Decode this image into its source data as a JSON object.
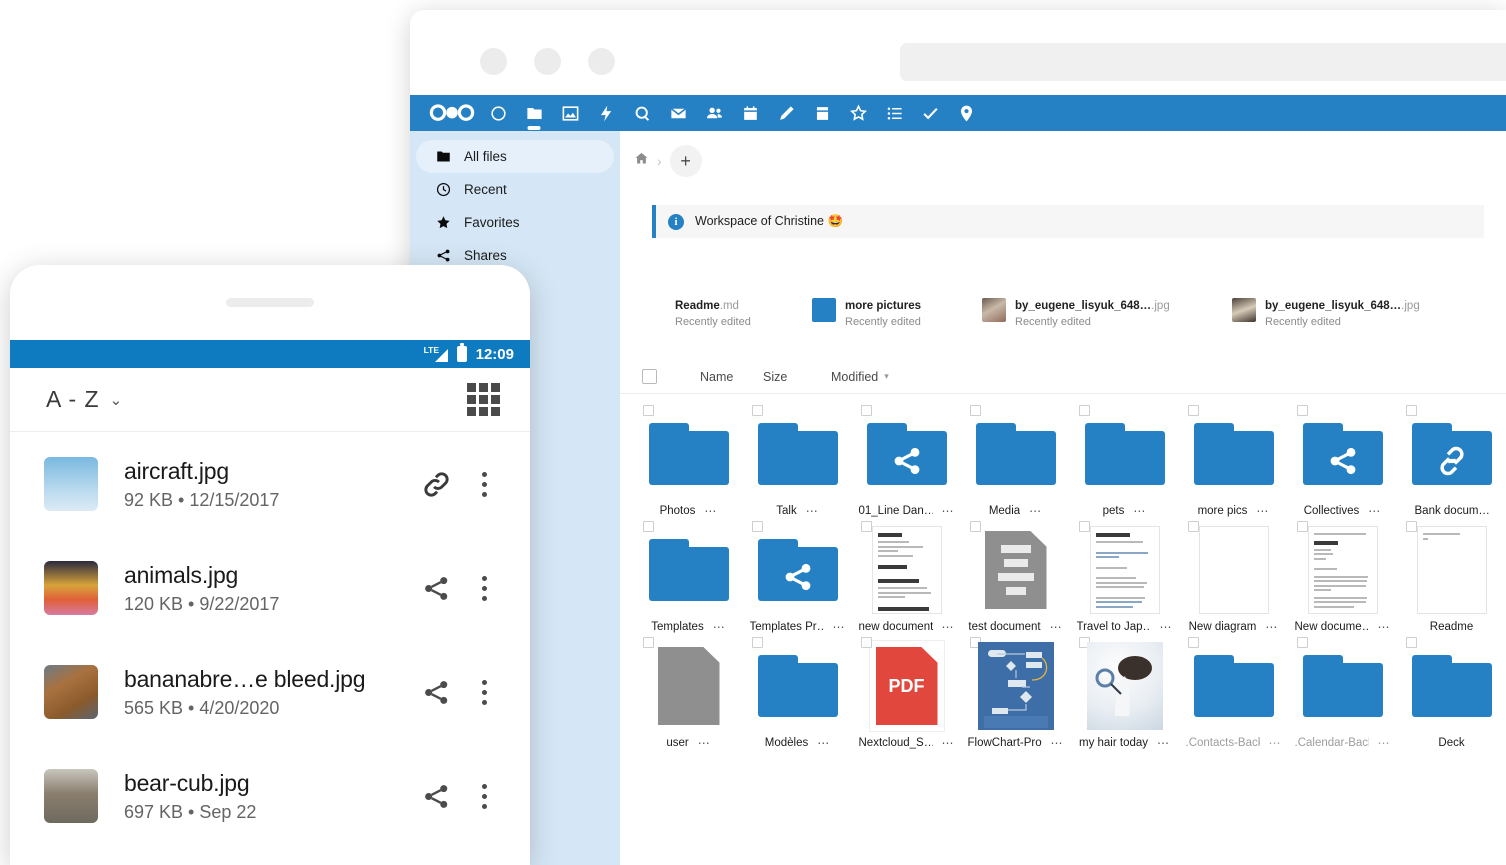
{
  "browser": {
    "traffic_lights": [
      "close",
      "minimize",
      "maximize"
    ],
    "address_value": "",
    "address_placeholder": ""
  },
  "nextcloud": {
    "brand_color": "#2581c4",
    "nav": [
      {
        "name": "logo",
        "icon": "nextcloud-logo"
      },
      {
        "name": "dashboard",
        "icon": "circle-icon",
        "active": false
      },
      {
        "name": "files",
        "icon": "folder-icon",
        "active": true
      },
      {
        "name": "photos",
        "icon": "image-icon",
        "active": false
      },
      {
        "name": "activity",
        "icon": "bolt-icon",
        "active": false
      },
      {
        "name": "search",
        "icon": "search-icon",
        "active": false
      },
      {
        "name": "mail",
        "icon": "mail-icon",
        "active": false
      },
      {
        "name": "contacts",
        "icon": "contacts-icon",
        "active": false
      },
      {
        "name": "calendar",
        "icon": "calendar-icon",
        "active": false
      },
      {
        "name": "notes",
        "icon": "pencil-icon",
        "active": false
      },
      {
        "name": "deck",
        "icon": "deck-icon",
        "active": false
      },
      {
        "name": "collectives",
        "icon": "star-burst-icon",
        "active": false
      },
      {
        "name": "tables",
        "icon": "list-icon",
        "active": false
      },
      {
        "name": "tasks",
        "icon": "check-icon",
        "active": false
      },
      {
        "name": "maps",
        "icon": "pin-icon",
        "active": false
      }
    ],
    "sidebar": {
      "items": [
        {
          "label": "All files",
          "icon": "folder-icon",
          "selected": true
        },
        {
          "label": "Recent",
          "icon": "clock-icon",
          "selected": false
        },
        {
          "label": "Favorites",
          "icon": "star-icon",
          "selected": false
        },
        {
          "label": "Shares",
          "icon": "share-icon",
          "selected": false
        }
      ]
    },
    "breadcrumb": {
      "home_icon": "home-icon",
      "separator": "›",
      "add_label": "+"
    },
    "workspace": {
      "icon": "info-icon",
      "text": "Workspace of Christine 🤩"
    },
    "recent": [
      {
        "name": "Readme",
        "ext": ".md",
        "sub": "Recently edited",
        "thumb": "text-file"
      },
      {
        "name": "more pictures",
        "ext": "",
        "sub": "Recently edited",
        "thumb": "folder"
      },
      {
        "name": "by_eugene_lisyuk_648…",
        "ext": ".jpg",
        "sub": "Recently edited",
        "thumb": "photo-woman"
      },
      {
        "name": "by_eugene_lisyuk_648…",
        "ext": ".jpg",
        "sub": "Recently edited",
        "thumb": "photo-rail"
      }
    ],
    "table_header": {
      "select_all": "checkbox",
      "name": "Name",
      "size": "Size",
      "modified": "Modified",
      "sort_caret": "▾"
    },
    "grid_rows": [
      [
        {
          "label": "Photos",
          "type": "folder",
          "shared": false
        },
        {
          "label": "Talk",
          "type": "folder",
          "shared": false
        },
        {
          "label": "01_Line Dan…",
          "type": "folder",
          "shared": true
        },
        {
          "label": "Media",
          "type": "folder",
          "shared": false
        },
        {
          "label": "pets",
          "type": "folder",
          "shared": false
        },
        {
          "label": "more pics",
          "type": "folder",
          "shared": false
        },
        {
          "label": "Collectives",
          "type": "folder",
          "shared": true
        },
        {
          "label": "Bank docum…",
          "type": "folder",
          "shared": true
        }
      ],
      [
        {
          "label": "Templates",
          "type": "folder",
          "shared": false
        },
        {
          "label": "Templates Pr…",
          "type": "folder",
          "shared": true
        },
        {
          "label": "new document",
          "type": "doc-cv",
          "shared": false
        },
        {
          "label": "test document",
          "type": "grey-doc",
          "shared": false
        },
        {
          "label": "Travel to Jap…",
          "type": "doc-travel",
          "shared": false
        },
        {
          "label": "New diagram",
          "type": "doc-blank",
          "shared": false
        },
        {
          "label": "New docume…",
          "type": "doc-letter",
          "shared": false
        },
        {
          "label": "Readme",
          "type": "doc-readme",
          "shared": false
        }
      ],
      [
        {
          "label": "user",
          "type": "grey-plain",
          "shared": false
        },
        {
          "label": "Modèles",
          "type": "folder",
          "shared": false
        },
        {
          "label": "Nextcloud_S…",
          "type": "pdf",
          "shared": false
        },
        {
          "label": "FlowChart-Pro",
          "type": "flowchart",
          "shared": false
        },
        {
          "label": "my hair today",
          "type": "photo-hair",
          "shared": false
        },
        {
          "label": ".Contacts-Backup",
          "type": "folder",
          "shared": false,
          "dim": true
        },
        {
          "label": ".Calendar-Backup",
          "type": "folder",
          "shared": false,
          "dim": true
        },
        {
          "label": "Deck",
          "type": "folder",
          "shared": false
        }
      ]
    ],
    "grid_overflow_label": "⋯"
  },
  "phone": {
    "status": {
      "network": "LTE",
      "battery_icon": "battery-icon",
      "time": "12:09"
    },
    "toolbar": {
      "sort_label": "A - Z",
      "sort_caret": "⌄",
      "view_toggle_icon": "grid-view-icon"
    },
    "files": [
      {
        "name": "aircraft.jpg",
        "meta": "92 KB • 12/15/2017",
        "action_icon": "link-icon",
        "thumb": "aircraft"
      },
      {
        "name": "animals.jpg",
        "meta": "120 KB • 9/22/2017",
        "action_icon": "share-icon",
        "thumb": "animals"
      },
      {
        "name": "bananabre…e bleed.jpg",
        "meta": "565 KB • 4/20/2020",
        "action_icon": "share-icon",
        "thumb": "bread"
      },
      {
        "name": "bear-cub.jpg",
        "meta": "697 KB • Sep 22",
        "action_icon": "share-icon",
        "thumb": "bear"
      }
    ],
    "kebab_label": "⋮"
  }
}
